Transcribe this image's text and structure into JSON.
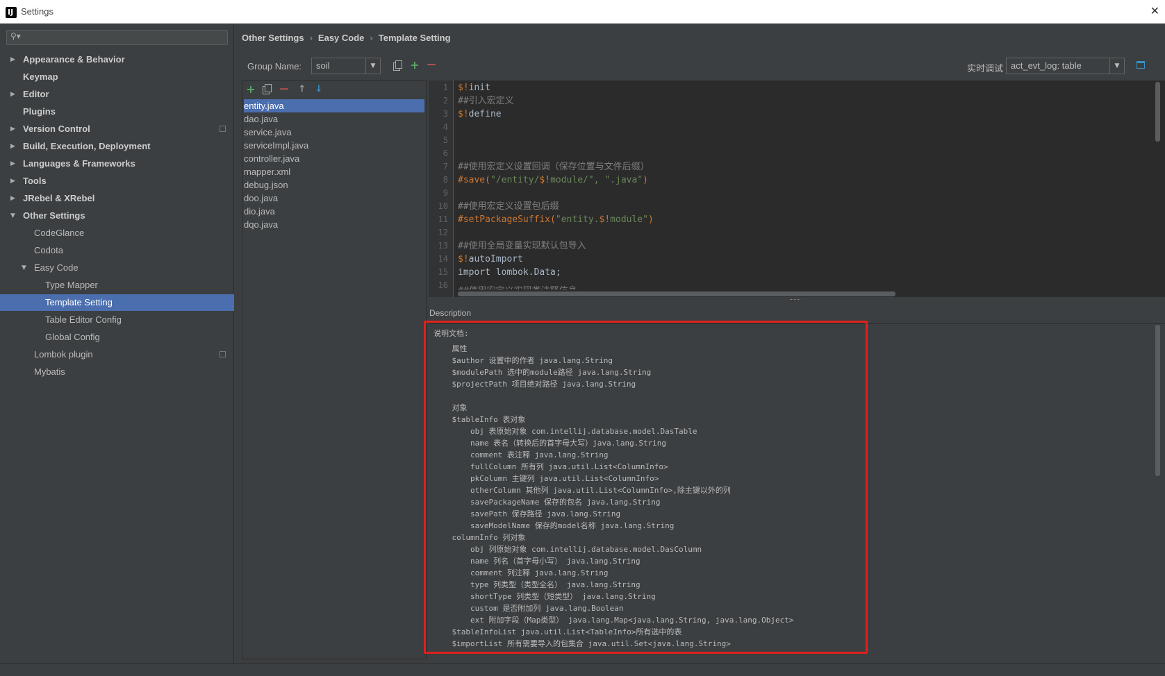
{
  "window": {
    "title": "Settings",
    "app_icon": "IJ",
    "close": "✕"
  },
  "sidebar": {
    "items": [
      {
        "label": "Appearance & Behavior",
        "arrow": "▶"
      },
      {
        "label": "Keymap"
      },
      {
        "label": "Editor",
        "arrow": "▶"
      },
      {
        "label": "Plugins"
      },
      {
        "label": "Version Control",
        "arrow": "▶"
      },
      {
        "label": "Build, Execution, Deployment",
        "arrow": "▶"
      },
      {
        "label": "Languages & Frameworks",
        "arrow": "▶"
      },
      {
        "label": "Tools",
        "arrow": "▶"
      },
      {
        "label": "JRebel & XRebel",
        "arrow": "▶"
      },
      {
        "label": "Other Settings",
        "arrow": "▼"
      },
      {
        "label": "CodeGlance"
      },
      {
        "label": "Codota"
      },
      {
        "label": "Easy Code",
        "arrow": "▼"
      },
      {
        "label": "Type Mapper"
      },
      {
        "label": "Template Setting"
      },
      {
        "label": "Table Editor Config"
      },
      {
        "label": "Global Config"
      },
      {
        "label": "Lombok plugin"
      },
      {
        "label": "Mybatis"
      }
    ]
  },
  "breadcrumb": {
    "items": [
      "Other Settings",
      "Easy Code",
      "Template Setting"
    ],
    "separator": "›"
  },
  "group": {
    "label": "Group Name:",
    "value": "soil"
  },
  "debug": {
    "label": "实时调试",
    "value": "act_evt_log: table"
  },
  "toolbar": {
    "add": "+",
    "remove": "—",
    "up": "↑",
    "down": "↓"
  },
  "files": {
    "items": [
      "entity.java",
      "dao.java",
      "service.java",
      "serviceImpl.java",
      "controller.java",
      "mapper.xml",
      "debug.json",
      "doo.java",
      "dio.java",
      "dqo.java"
    ],
    "selected": "entity.java"
  },
  "editor": {
    "line_numbers": [
      "1",
      "2",
      "3",
      "4",
      "5",
      "6",
      "7",
      "8",
      "9",
      "10",
      "11",
      "12",
      "13",
      "14",
      "15",
      "16"
    ],
    "lines": {
      "l1a": "$!",
      "l1b": "init",
      "l2": "##引入宏定义",
      "l3a": "$!",
      "l3b": "define",
      "l7": "##使用宏定义设置回调（保存位置与文件后缀）",
      "l8a": "#save(",
      "l8b": "\"/entity/",
      "l8c": "$!",
      "l8d": "module",
      "l8e": "/\", \".java\"",
      "l8f": ")",
      "l10": "##使用宏定义设置包后缀",
      "l11a": "#setPackageSuffix(",
      "l11b": "\"entity.",
      "l11c": "$!",
      "l11d": "module",
      "l11e": "\"",
      "l11f": ")",
      "l13": "##使用全局变量实现默认包导入",
      "l14a": "$!",
      "l14b": "autoImport",
      "l15": "import lombok.Data;",
      "l16": "##使用宏定义实现类注释信息"
    }
  },
  "description": {
    "label": "Description",
    "lines": [
      "说明文档:",
      "    属性",
      "    $author 设置中的作者 java.lang.String",
      "    $modulePath 选中的module路径 java.lang.String",
      "    $projectPath 项目绝对路径 java.lang.String",
      "",
      "    对象",
      "    $tableInfo 表对象",
      "        obj 表原始对象 com.intellij.database.model.DasTable",
      "        name 表名（转换后的首字母大写）java.lang.String",
      "        comment 表注释 java.lang.String",
      "        fullColumn 所有列 java.util.List<ColumnInfo>",
      "        pkColumn 主键列 java.util.List<ColumnInfo>",
      "        otherColumn 其他列 java.util.List<ColumnInfo>,除主键以外的列",
      "        savePackageName 保存的包名 java.lang.String",
      "        savePath 保存路径 java.lang.String",
      "        saveModelName 保存的model名称 java.lang.String",
      "    columnInfo 列对象",
      "        obj 列原始对象 com.intellij.database.model.DasColumn",
      "        name 列名（首字母小写） java.lang.String",
      "        comment 列注释 java.lang.String",
      "        type 列类型（类型全名） java.lang.String",
      "        shortType 列类型（短类型） java.lang.String",
      "        custom 是否附加列 java.lang.Boolean",
      "        ext 附加字段（Map类型） java.lang.Map<java.lang.String, java.lang.Object>",
      "    $tableInfoList java.util.List<TableInfo>所有选中的表",
      "    $importList 所有需要导入的包集合 java.util.Set<java.lang.String>"
    ]
  },
  "colors": {
    "background": "#3c3f41",
    "editor_bg": "#2b2b2b",
    "selection": "#4b6eaf",
    "keyword": "#cc7832",
    "comment": "#808080",
    "string": "#6a8759",
    "highlight_border": "#e0201d"
  }
}
